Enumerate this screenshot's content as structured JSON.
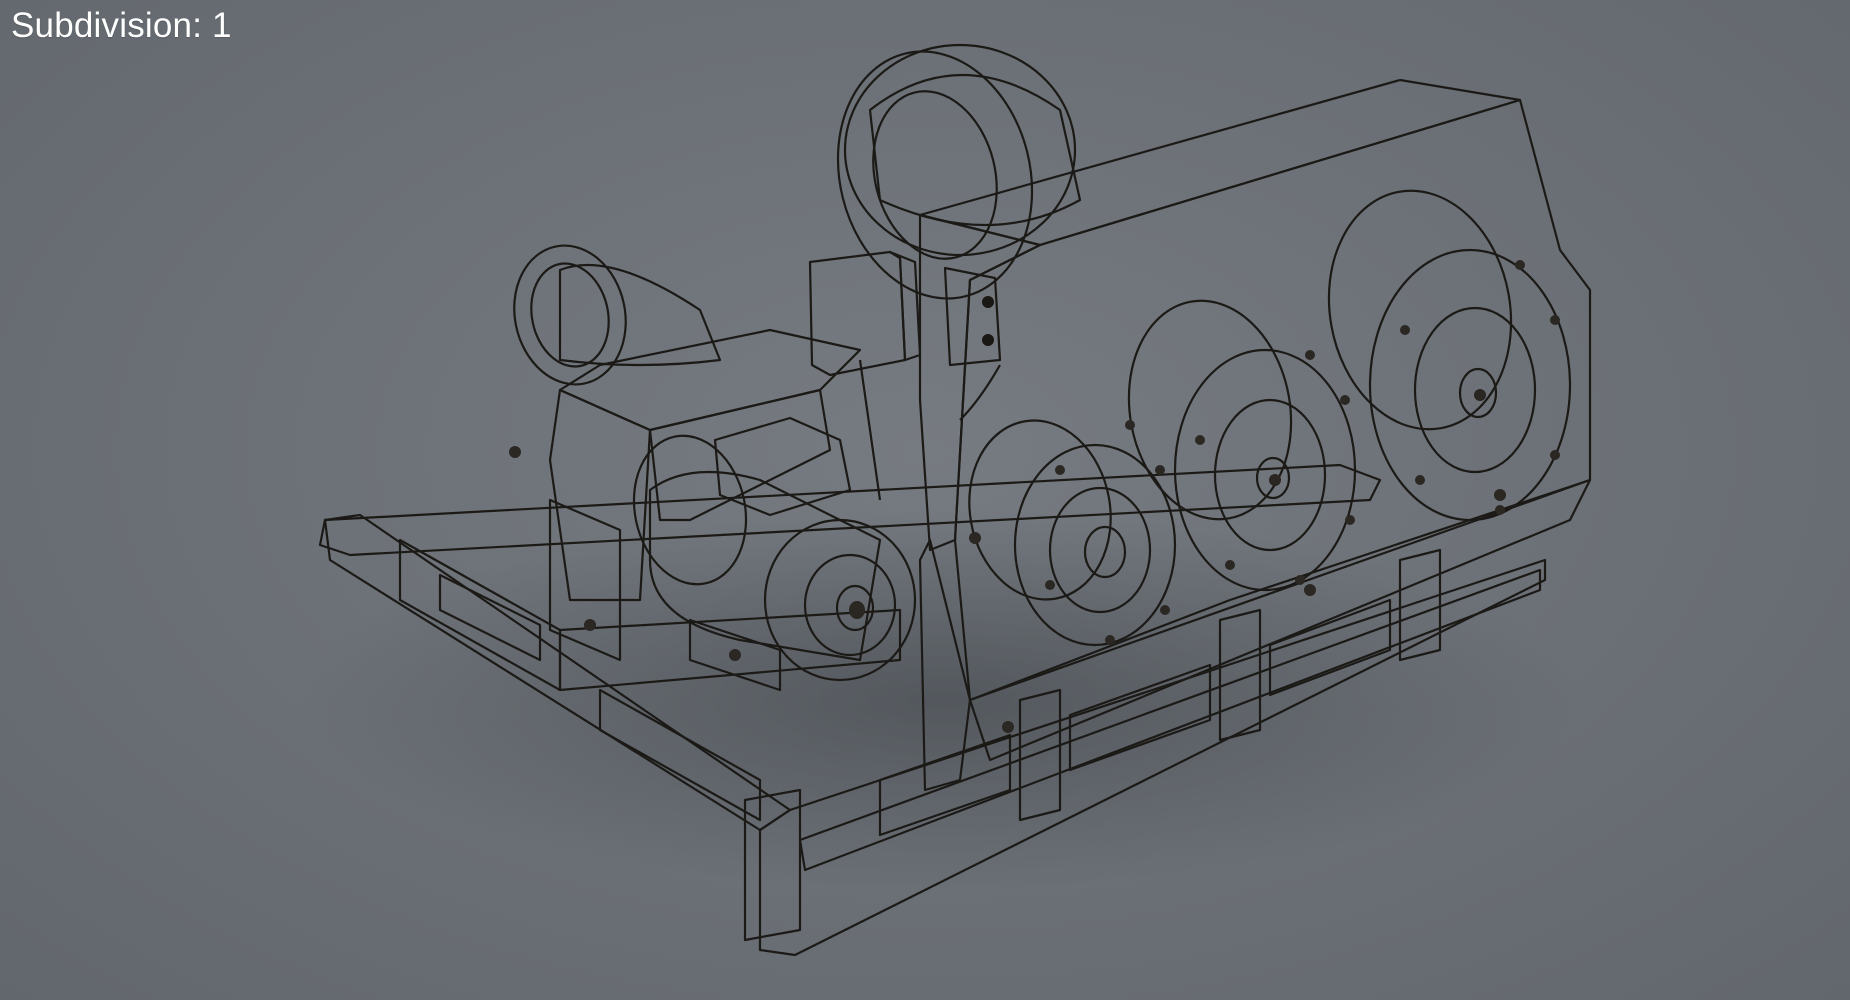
{
  "viewport": {
    "overlay_label": "Subdivision: 1",
    "background_color": "#6e7379"
  },
  "model": {
    "subject": "industrial-winch",
    "display_mode": "wireframe-on-shaded",
    "surface_color": "#e6d9c5",
    "wire_color": "#2a2622"
  }
}
